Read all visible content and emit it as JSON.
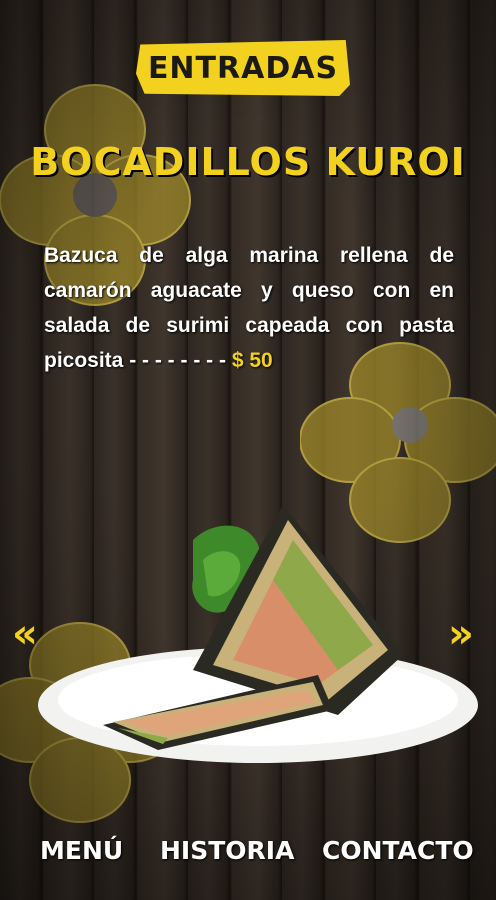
{
  "category": "ENTRADAS",
  "dish": {
    "title": "BOCADILLOS KUROI",
    "description": "Bazuca de alga marina rellena de camarón aguacate y queso con en salada de surimi capeada con pasta picosita - - - - - - - -",
    "price": "$ 50"
  },
  "carousel": {
    "prev_icon": "double-chevron-left-icon",
    "next_icon": "double-chevron-right-icon"
  },
  "nav": {
    "menu": "MENÚ",
    "history": "HISTORIA",
    "contact": "CONTACTO"
  },
  "colors": {
    "accent": "#f3d21f",
    "text": "#ffffff",
    "background": "#2e2721"
  }
}
